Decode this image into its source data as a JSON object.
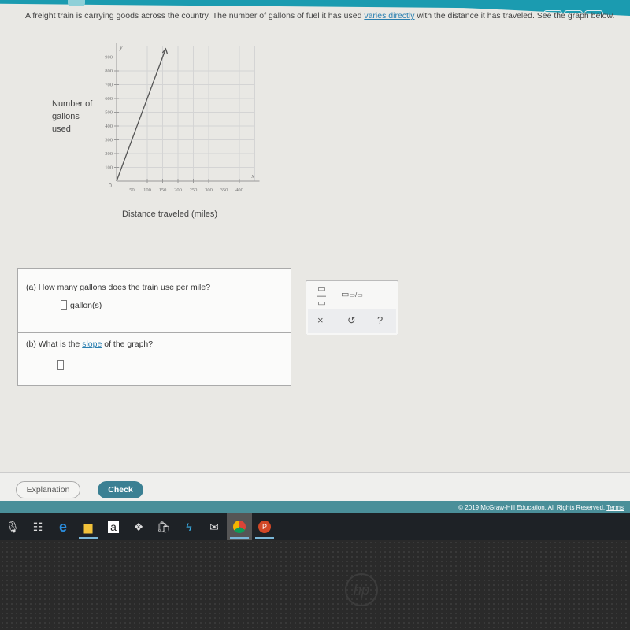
{
  "problem": {
    "text_before": "A freight train is carrying goods across the country. The number of gallons of fuel it has used ",
    "link": "varies directly",
    "text_after": " with the distance it has traveled. See the graph below."
  },
  "chart_data": {
    "type": "line",
    "xlabel": "Distance traveled (miles)",
    "ylabel": "Number of gallons used",
    "x_axis_letter": "x",
    "y_axis_letter": "y",
    "origin_label": "0",
    "x_ticks": [
      50,
      100,
      150,
      200,
      250,
      300,
      350,
      400
    ],
    "y_ticks": [
      100,
      200,
      300,
      400,
      500,
      600,
      700,
      800,
      900
    ],
    "xlim": [
      0,
      450
    ],
    "ylim": [
      0,
      980
    ],
    "grid": true,
    "series": [
      {
        "points": [
          [
            0,
            0
          ],
          [
            160,
            960
          ]
        ],
        "arrow": true
      }
    ]
  },
  "question_a": {
    "label": "(a) How many gallons does the train use per mile?",
    "unit": "gallon(s)"
  },
  "question_b": {
    "before": "(b) What is the ",
    "link": "slope",
    "after": " of the graph?"
  },
  "tools": {
    "fraction": "fraction-icon",
    "mixed": "mixed-number-icon",
    "clear": "×",
    "undo": "↺",
    "help": "?"
  },
  "buttons": {
    "explanation": "Explanation",
    "check": "Check"
  },
  "footer": {
    "copyright": "© 2019 McGraw-Hill Education. All Rights Reserved.",
    "terms": "Terms"
  },
  "taskbar": [
    "microphone-icon",
    "task-view-icon",
    "edge-icon",
    "file-explorer-icon",
    "amazon-icon",
    "dropbox-icon",
    "store-icon",
    "app-bolt-icon",
    "mail-icon",
    "chrome-icon",
    "powerpoint-icon"
  ],
  "colors": {
    "accent": "#1b9bb0",
    "check": "#3b8093",
    "footer": "#4a8f99"
  },
  "bezel_logo": "hp"
}
